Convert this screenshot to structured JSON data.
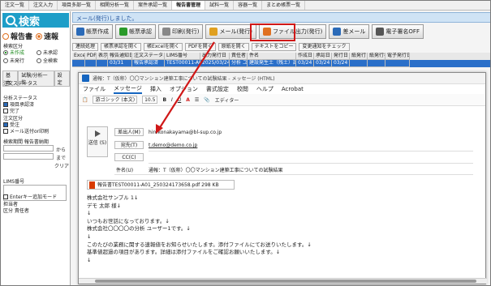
{
  "top_tabs": [
    "注文一覧",
    "注文入力",
    "項目多部一覧",
    "相関分析一覧",
    "案件承認一覧",
    "報告書管理",
    "試料一覧",
    "容器一覧",
    "まとめ帳票一覧"
  ],
  "sidebar": {
    "search_label": "検索",
    "radio_report": "報告書",
    "radio_express": "速報",
    "report_section_label": "検索区分",
    "opt_unsent": "未作成",
    "opt_all_pub": "未承認",
    "opt_not_issued": "未発行",
    "opt_all": "全検索",
    "tab_basic": "基本",
    "tab_test": "試験/分析一覧",
    "tab_settings": "設定",
    "status_label": "注文ステータス",
    "analysis_label": "分析ステータス",
    "pending_label": "項目承認済",
    "done_label": "完了",
    "section_label": "注文区分",
    "order_label": "受注",
    "mail_label": "メール送付or印刷",
    "period_label": "検索期間 報告書納期",
    "from_label": "から",
    "to_label": "まで",
    "clear_label": "クリア",
    "lims_label": "LIMS番号",
    "enter_label": "Enterキー追加モード",
    "person_label": "担当者",
    "class_label": "区分 責任者"
  },
  "main": {
    "message": "メール(発行)しました。",
    "toolbar": [
      "帳票作成",
      "帳票承認",
      "印刷(発行)",
      "メール(発行)",
      "ファイル出力(発行)",
      "差メール",
      "電子署名OFF"
    ],
    "toolbar2": [
      "連続処理",
      "帳票承認を開く",
      "帳Excelを開く",
      "PDFを開く",
      "原紙を開く",
      "テキストをコピー",
      "変更通知をチェック"
    ],
    "grid_headers": [
      "Excel",
      "PDF",
      "表示",
      "報告通知日",
      "注文ステータス",
      "LIMS番号",
      "出力発行日",
      "責任者",
      "件名",
      "作成日",
      "承認日",
      "発行日",
      "紙発行日",
      "紙発行者",
      "電子発行日"
    ],
    "grid_row": [
      "",
      "",
      "",
      "03/31",
      "報告承認済",
      "TEST00011-A01",
      "2025/03/24",
      "分析 ユ",
      "建設発生土（残土）試験",
      "03/24",
      "03/24",
      "03/24",
      "",
      "",
      ""
    ]
  },
  "outlook": {
    "title": "通報：T（仮称）〇〇マンション建築工事についての試験結果 - メッセージ (HTML)",
    "menu": [
      "ファイル",
      "メッセージ",
      "挿入",
      "オプション",
      "書式設定",
      "校閲",
      "ヘルプ",
      "Acrobat"
    ],
    "font_name": "游ゴシック (本文)",
    "font_size": "10.5",
    "editor_label": "エディター",
    "send_label": "送信 (S)",
    "from_btn": "差出人(M)",
    "from_val": "hirokonakayama@bl-sup.co.jp",
    "to_btn": "宛先(T)",
    "to_val": "t.demo@demo.co.jp",
    "cc_btn": "CC(C)",
    "subject_label": "件名(U)",
    "subject_val": "通報：T（仮称）〇〇マンション建築工事についての試験結果",
    "attachment": "報告書TEST00011-A01_250324173658.pdf",
    "attachment_size": "298 KB",
    "body": [
      "株式会社サンプル 1↓",
      "デモ 太郎 様↓",
      "↓",
      "いつもお世話になっております。↓",
      "株式会社〇〇〇〇の分析 ユーザー1です。↓",
      "↓",
      "このたびの業務に関する速報値をお知らせいたします。添付ファイルにてお送りいたします。↓",
      "基準値超過の項目があります。詳細は添付ファイルをご確認お願いいたします。↓",
      "↓"
    ]
  },
  "colors": {
    "accent": "#1e9ec8",
    "radio": "#e07020",
    "selected_row": "#2a6fc9",
    "highlight": "#d01818"
  }
}
